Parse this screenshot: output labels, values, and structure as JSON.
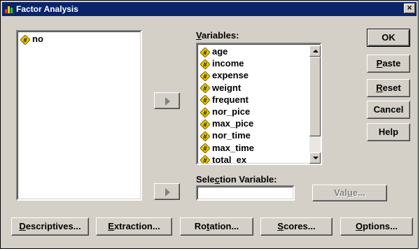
{
  "window": {
    "title": "Factor Analysis",
    "close_label": "×"
  },
  "source_list": {
    "items": [
      "no"
    ]
  },
  "variables": {
    "label_pre": "",
    "label_u": "V",
    "label_post": "ariables:",
    "items": [
      "age",
      "income",
      "expense",
      "weignt",
      "frequent",
      "nor_pice",
      "max_pice",
      "nor_time",
      "max_time",
      "total_ex"
    ]
  },
  "selection": {
    "label_pre": "Sele",
    "label_u": "c",
    "label_post": "tion Variable:",
    "value": ""
  },
  "value_button": {
    "pre": "Val",
    "u": "u",
    "post": "e..."
  },
  "side_buttons": {
    "ok": "OK",
    "paste": {
      "pre": "",
      "u": "P",
      "post": "aste"
    },
    "reset": {
      "pre": "",
      "u": "R",
      "post": "eset"
    },
    "cancel": "Cancel",
    "help": "Help"
  },
  "bottom_buttons": {
    "descriptives": {
      "pre": "",
      "u": "D",
      "post": "escriptives..."
    },
    "extraction": {
      "pre": "",
      "u": "E",
      "post": "xtraction..."
    },
    "rotation": {
      "pre": "Ro",
      "u": "t",
      "post": "ation..."
    },
    "scores": {
      "pre": "",
      "u": "S",
      "post": "cores..."
    },
    "options": {
      "pre": "",
      "u": "O",
      "post": "ptions..."
    }
  },
  "icons": {
    "title": "spss-icon",
    "variable": "numeric-variable-icon",
    "move": "arrow-right-icon"
  },
  "colors": {
    "titlebar": "#0a246a",
    "face": "#d4d0c8",
    "icon_yellow": "#e8c800"
  }
}
